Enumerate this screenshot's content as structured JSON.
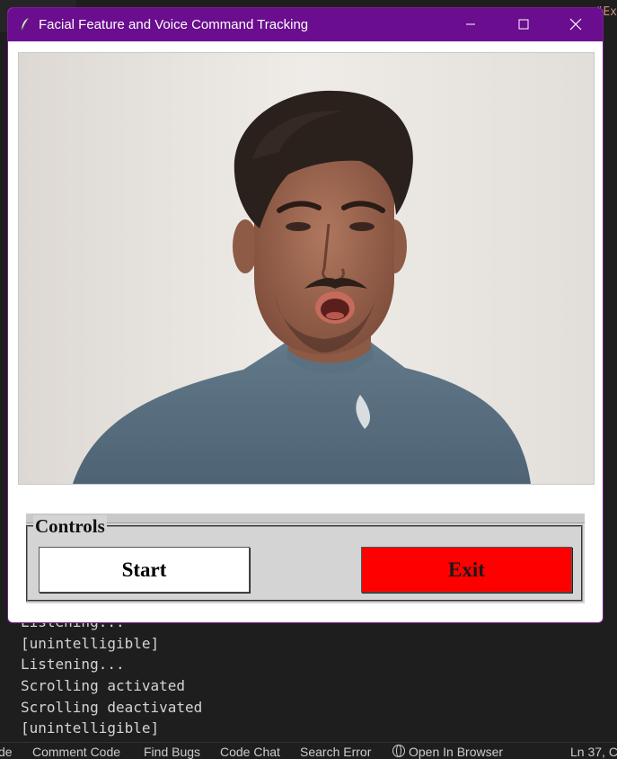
{
  "window": {
    "title": "Facial Feature and Voice Command Tracking",
    "titlebar_color": "#6a0d8e"
  },
  "controls": {
    "label": "Controls",
    "start_label": "Start",
    "exit_label": "Exit",
    "exit_color": "#ff0000"
  },
  "background_editor": {
    "code_fragment": "\"Ex"
  },
  "terminal": {
    "lines": [
      "Listening...",
      "[unintelligible]",
      "Listening...",
      "Scrolling activated",
      "Scrolling deactivated",
      "[unintelligible]"
    ]
  },
  "statusbar": {
    "items": [
      "de",
      "Comment Code",
      "Find Bugs",
      "Code Chat",
      "Search Error",
      "Open In Browser"
    ],
    "position": "Ln 37, C"
  },
  "icons": [
    "feather-icon",
    "minimize-icon",
    "maximize-icon",
    "close-icon",
    "globe-icon"
  ]
}
